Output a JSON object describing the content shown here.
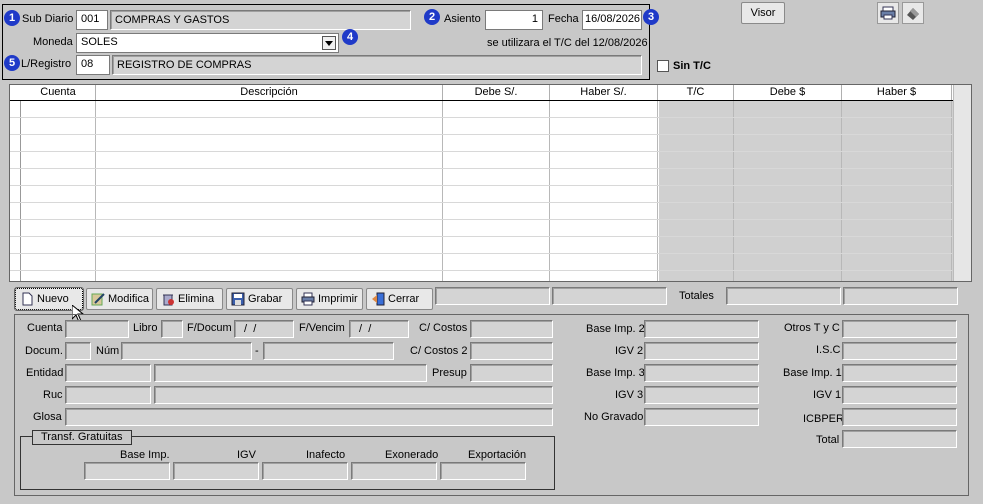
{
  "header": {
    "sub_diario_label": "Sub Diario",
    "sub_diario_code": "001",
    "sub_diario_name": "COMPRAS Y GASTOS",
    "asiento_label": "Asiento",
    "asiento_value": "1",
    "fecha_label": "Fecha",
    "fecha_value": "16/08/2026",
    "moneda_label": "Moneda",
    "moneda_value": "SOLES",
    "tc_note": "se utilizara el T/C del 12/08/2026",
    "lregistro_label": "L/Registro",
    "lregistro_code": "08",
    "lregistro_name": "REGISTRO DE COMPRAS",
    "sin_tc_label": "Sin T/C",
    "visor_label": "Visor",
    "badges": [
      "1",
      "2",
      "3",
      "4",
      "5"
    ]
  },
  "grid": {
    "columns": [
      "Cuenta",
      "Descripción",
      "Debe S/.",
      "Haber S/.",
      "T/C",
      "Debe $",
      "Haber $"
    ]
  },
  "toolbar": {
    "nuevo": "Nuevo",
    "modifica": "Modifica",
    "elimina": "Elimina",
    "grabar": "Grabar",
    "imprimir": "Imprimir",
    "cerrar": "Cerrar",
    "totales_label": "Totales"
  },
  "detail": {
    "cuenta": "Cuenta",
    "libro": "Libro",
    "fdocum": "F/Docum",
    "fdocum_value": " /  /",
    "fvencim": "F/Vencim",
    "fvencim_value": " /  /",
    "c_costos": "C/ Costos",
    "docum": "Docum.",
    "num": "Núm",
    "dash": "-",
    "c_costos2": "C/ Costos 2",
    "entidad": "Entidad",
    "presup": "Presup",
    "ruc": "Ruc",
    "glosa": "Glosa",
    "base_imp2": "Base Imp. 2",
    "igv2": "IGV 2",
    "base_imp3": "Base Imp. 3",
    "igv3": "IGV 3",
    "no_gravado": "No Gravado",
    "otros_tyc": "Otros T y C",
    "isc": "I.S.C",
    "base_imp1": "Base Imp. 1",
    "igv1": "IGV 1",
    "icbper": "ICBPER",
    "total": "Total"
  },
  "transf": {
    "title": "Transf. Gratuitas",
    "base_imp": "Base Imp.",
    "igv": "IGV",
    "inafecto": "Inafecto",
    "exonerado": "Exonerado",
    "exportacion": "Exportación"
  }
}
